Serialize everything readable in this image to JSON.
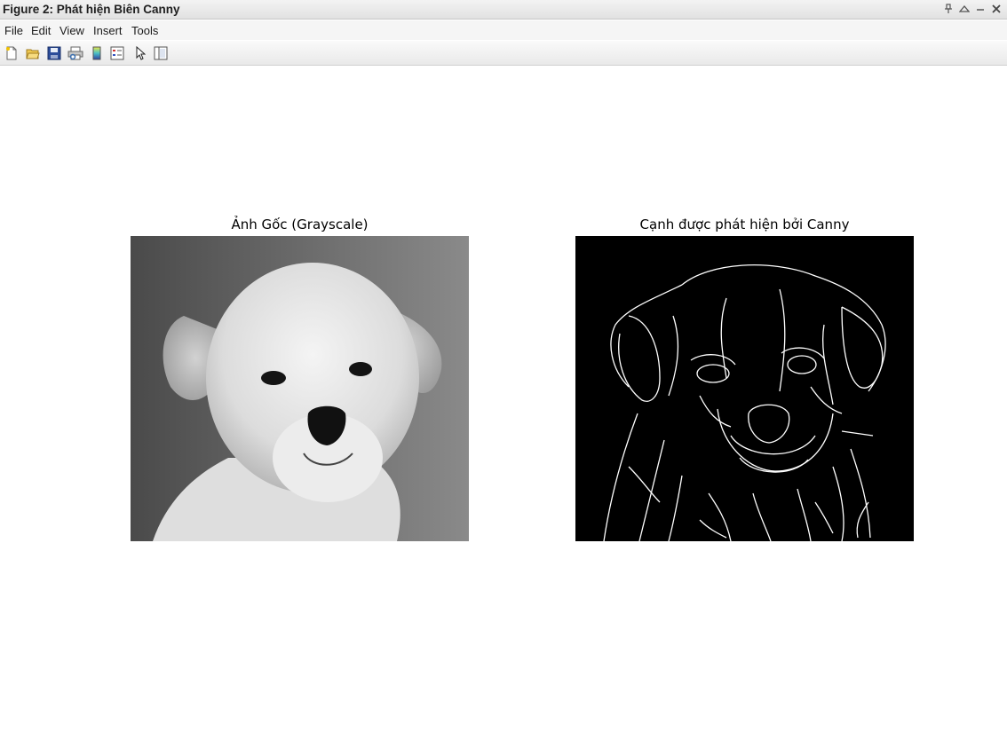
{
  "window": {
    "title": "Figure 2: Phát hiện Biên Canny"
  },
  "menu": {
    "items": [
      "File",
      "Edit",
      "View",
      "Insert",
      "Tools"
    ]
  },
  "toolbar": {
    "icons": [
      "new-figure-icon",
      "open-file-icon",
      "save-icon",
      "print-icon",
      "colorbar-icon",
      "legend-icon",
      "pointer-icon",
      "property-editor-icon"
    ]
  },
  "figure": {
    "left_title": "Ảnh Gốc (Grayscale)",
    "right_title": "Cạnh được phát hiện bởi Canny"
  }
}
